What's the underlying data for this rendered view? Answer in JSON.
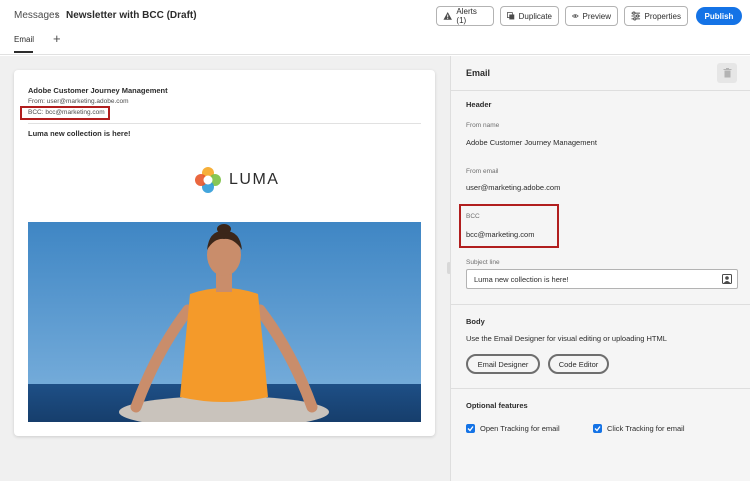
{
  "header": {
    "breadcrumb_root": "Messages",
    "breadcrumb_separator": "›",
    "title": "Newsletter with BCC (Draft)",
    "buttons": {
      "alerts": "Alerts (1)",
      "duplicate": "Duplicate",
      "preview": "Preview",
      "properties": "Properties",
      "publish": "Publish"
    }
  },
  "tabs": [
    {
      "label": "Email",
      "active": true
    },
    {
      "label": "+",
      "icon": "add-icon"
    }
  ],
  "preview": {
    "sender_name": "Adobe Customer Journey Management",
    "from_line": "From: user@marketing.adobe.com",
    "bcc_line": "BCC: bcc@marketing.com",
    "subject": "Luma new collection is here!",
    "logo_text": "LUMA",
    "hero_image": "woman-meditating-photo"
  },
  "panel": {
    "title": "Email",
    "header_section": "Header",
    "from_name_label": "From name",
    "from_name_value": "Adobe Customer Journey Management",
    "from_email_label": "From email",
    "from_email_value": "user@marketing.adobe.com",
    "bcc_label": "BCC",
    "bcc_value": "bcc@marketing.com",
    "subject_label": "Subject line",
    "subject_value": "Luma new collection is here!",
    "body_section": "Body",
    "body_description": "Use the Email Designer for visual editing or uploading HTML",
    "email_designer_button": "Email Designer",
    "code_editor_button": "Code Editor",
    "optional_section": "Optional features",
    "open_tracking_label": "Open Tracking for email",
    "open_tracking_checked": true,
    "click_tracking_label": "Click Tracking for email",
    "click_tracking_checked": true
  },
  "colors": {
    "accent": "#1473e6",
    "highlight": "#b11e1e"
  }
}
